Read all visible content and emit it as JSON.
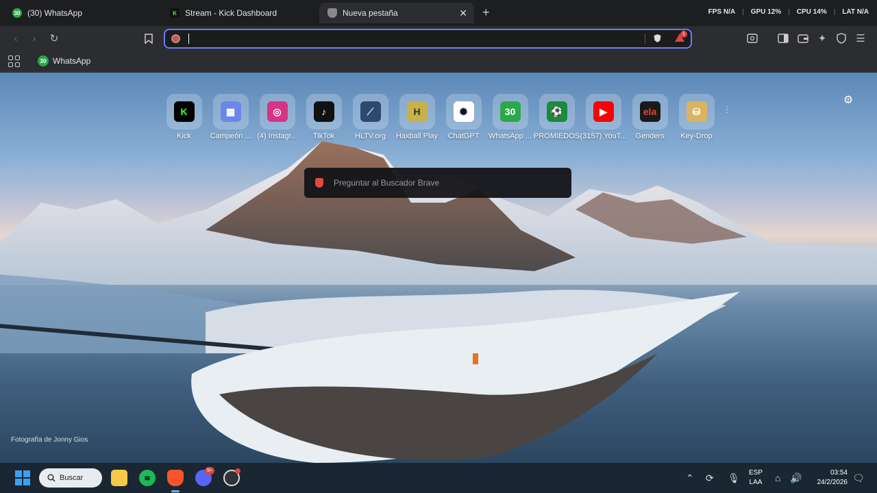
{
  "tabs": [
    {
      "title": "(30) WhatsApp",
      "badge": "30",
      "color": "#2aa84a"
    },
    {
      "title": "Stream - Kick Dashboard",
      "badge": "K",
      "color": "#53fc18"
    },
    {
      "title": "Nueva pestaña",
      "badge": "",
      "color": "#888888"
    }
  ],
  "stats": {
    "fps": "FPS N/A",
    "gpu": "GPU 12%",
    "cpu": "CPU 14%",
    "lat": "LAT N/A"
  },
  "omnibox": {
    "value": "",
    "rewards_badge": "1"
  },
  "bookmarks": [
    {
      "label": "WhatsApp",
      "badge": "30"
    }
  ],
  "top_sites": [
    {
      "label": "Kick",
      "glyph": "K",
      "bg": "#000000",
      "fg": "#53fc18"
    },
    {
      "label": "Campeón ...",
      "glyph": "▦",
      "bg": "#6d87e8",
      "fg": "#ffffff"
    },
    {
      "label": "(4) Instagr...",
      "glyph": "◎",
      "bg": "#d63484",
      "fg": "#ffffff"
    },
    {
      "label": "TikTok",
      "glyph": "♪",
      "bg": "#111111",
      "fg": "#ffffff"
    },
    {
      "label": "HLTV.org",
      "glyph": "⟋",
      "bg": "#2c4a6e",
      "fg": "#cfe0f5"
    },
    {
      "label": "Haxball Play",
      "glyph": "H",
      "bg": "#c9b04a",
      "fg": "#1e3b20"
    },
    {
      "label": "ChatGPT",
      "glyph": "✺",
      "bg": "#ffffff",
      "fg": "#111111"
    },
    {
      "label": "WhatsApp ...",
      "glyph": "30",
      "bg": "#2aa84a",
      "fg": "#ffffff"
    },
    {
      "label": "PROMIEDOS",
      "glyph": "⚽",
      "bg": "#1b8a3a",
      "fg": "#ffffff"
    },
    {
      "label": "(3157) YouT...",
      "glyph": "▶",
      "bg": "#ff0000",
      "fg": "#ffffff"
    },
    {
      "label": "Genders",
      "glyph": "ela",
      "bg": "#1a1a1a",
      "fg": "#e0483c"
    },
    {
      "label": "Key-Drop",
      "glyph": "⛁",
      "bg": "#d9b560",
      "fg": "#ffffff"
    }
  ],
  "search_prompt": "Preguntar al Buscador Brave",
  "photo_credit": "Fotografía de Jonny Gios",
  "taskbar": {
    "search_label": "Buscar",
    "lang_top": "ESP",
    "lang_bottom": "LAA",
    "time": "03:54",
    "date": "24/2/2026",
    "discord_badge": "9+"
  }
}
